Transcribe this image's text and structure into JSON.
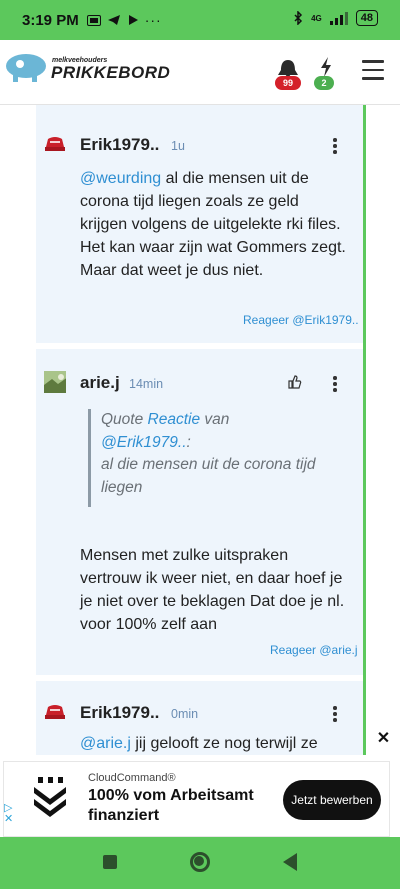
{
  "status_bar": {
    "time": "3:19 PM",
    "network": "4G",
    "battery": "48"
  },
  "header": {
    "logo_small": "melkveehouders",
    "logo_big": "PRIKKEBORD",
    "notifications_count": "99",
    "bolt_count": "2"
  },
  "comments": [
    {
      "author": "Erik1979..",
      "time": "1u",
      "mention": "@weurding",
      "text": " al die mensen uit de corona tijd liegen zoals ze geld krijgen volgens de uitgelekte rki files. Het kan waar zijn wat Gommers zegt. Maar dat weet je dus niet.",
      "reply_label": "Reageer @Erik1979.."
    },
    {
      "author": "arie.j",
      "time": "14min",
      "quote_prefix": "Quote ",
      "quote_link": "Reactie",
      "quote_mid": " van ",
      "quote_user": "@Erik1979..",
      "quote_colon": ":",
      "quote_text": "al die mensen uit de corona tijd liegen",
      "text": "Mensen met zulke uitspraken vertrouw ik weer niet, en daar hoef je je niet over te beklagen Dat doe je nl. voor 100% zelf aan",
      "reply_label": "Reageer @arie.j"
    },
    {
      "author": "Erik1979..",
      "time": "0min",
      "mention": "@arie.j",
      "text": " jij gelooft ze nog terwijl ze"
    }
  ],
  "ad": {
    "close": "✕",
    "brand": "CloudCommand®",
    "headline": "100% vom Arbeitsamt finanziert",
    "cta": "Jetzt bewerben"
  },
  "colors": {
    "accent_green": "#5cc85c",
    "link_blue": "#2f8fd2",
    "card_bg": "#eef5fc",
    "badge_red": "#d4202a"
  }
}
